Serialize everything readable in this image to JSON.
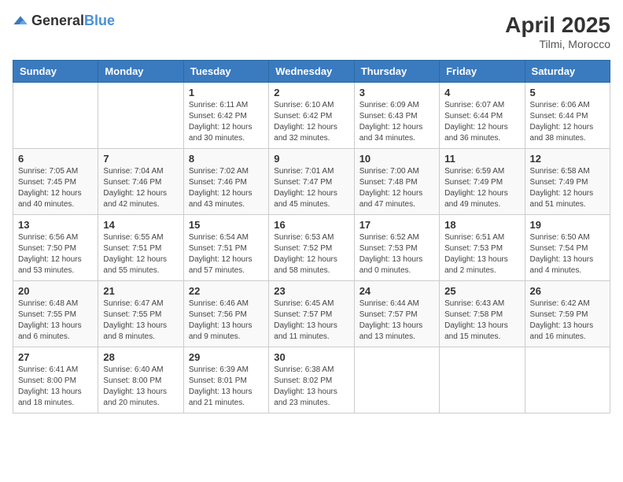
{
  "header": {
    "logo_general": "General",
    "logo_blue": "Blue",
    "month_title": "April 2025",
    "location": "Tilmi, Morocco"
  },
  "days_of_week": [
    "Sunday",
    "Monday",
    "Tuesday",
    "Wednesday",
    "Thursday",
    "Friday",
    "Saturday"
  ],
  "weeks": [
    [
      {
        "day": null,
        "info": null
      },
      {
        "day": null,
        "info": null
      },
      {
        "day": "1",
        "info": "Sunrise: 6:11 AM\nSunset: 6:42 PM\nDaylight: 12 hours and 30 minutes."
      },
      {
        "day": "2",
        "info": "Sunrise: 6:10 AM\nSunset: 6:42 PM\nDaylight: 12 hours and 32 minutes."
      },
      {
        "day": "3",
        "info": "Sunrise: 6:09 AM\nSunset: 6:43 PM\nDaylight: 12 hours and 34 minutes."
      },
      {
        "day": "4",
        "info": "Sunrise: 6:07 AM\nSunset: 6:44 PM\nDaylight: 12 hours and 36 minutes."
      },
      {
        "day": "5",
        "info": "Sunrise: 6:06 AM\nSunset: 6:44 PM\nDaylight: 12 hours and 38 minutes."
      }
    ],
    [
      {
        "day": "6",
        "info": "Sunrise: 7:05 AM\nSunset: 7:45 PM\nDaylight: 12 hours and 40 minutes."
      },
      {
        "day": "7",
        "info": "Sunrise: 7:04 AM\nSunset: 7:46 PM\nDaylight: 12 hours and 42 minutes."
      },
      {
        "day": "8",
        "info": "Sunrise: 7:02 AM\nSunset: 7:46 PM\nDaylight: 12 hours and 43 minutes."
      },
      {
        "day": "9",
        "info": "Sunrise: 7:01 AM\nSunset: 7:47 PM\nDaylight: 12 hours and 45 minutes."
      },
      {
        "day": "10",
        "info": "Sunrise: 7:00 AM\nSunset: 7:48 PM\nDaylight: 12 hours and 47 minutes."
      },
      {
        "day": "11",
        "info": "Sunrise: 6:59 AM\nSunset: 7:49 PM\nDaylight: 12 hours and 49 minutes."
      },
      {
        "day": "12",
        "info": "Sunrise: 6:58 AM\nSunset: 7:49 PM\nDaylight: 12 hours and 51 minutes."
      }
    ],
    [
      {
        "day": "13",
        "info": "Sunrise: 6:56 AM\nSunset: 7:50 PM\nDaylight: 12 hours and 53 minutes."
      },
      {
        "day": "14",
        "info": "Sunrise: 6:55 AM\nSunset: 7:51 PM\nDaylight: 12 hours and 55 minutes."
      },
      {
        "day": "15",
        "info": "Sunrise: 6:54 AM\nSunset: 7:51 PM\nDaylight: 12 hours and 57 minutes."
      },
      {
        "day": "16",
        "info": "Sunrise: 6:53 AM\nSunset: 7:52 PM\nDaylight: 12 hours and 58 minutes."
      },
      {
        "day": "17",
        "info": "Sunrise: 6:52 AM\nSunset: 7:53 PM\nDaylight: 13 hours and 0 minutes."
      },
      {
        "day": "18",
        "info": "Sunrise: 6:51 AM\nSunset: 7:53 PM\nDaylight: 13 hours and 2 minutes."
      },
      {
        "day": "19",
        "info": "Sunrise: 6:50 AM\nSunset: 7:54 PM\nDaylight: 13 hours and 4 minutes."
      }
    ],
    [
      {
        "day": "20",
        "info": "Sunrise: 6:48 AM\nSunset: 7:55 PM\nDaylight: 13 hours and 6 minutes."
      },
      {
        "day": "21",
        "info": "Sunrise: 6:47 AM\nSunset: 7:55 PM\nDaylight: 13 hours and 8 minutes."
      },
      {
        "day": "22",
        "info": "Sunrise: 6:46 AM\nSunset: 7:56 PM\nDaylight: 13 hours and 9 minutes."
      },
      {
        "day": "23",
        "info": "Sunrise: 6:45 AM\nSunset: 7:57 PM\nDaylight: 13 hours and 11 minutes."
      },
      {
        "day": "24",
        "info": "Sunrise: 6:44 AM\nSunset: 7:57 PM\nDaylight: 13 hours and 13 minutes."
      },
      {
        "day": "25",
        "info": "Sunrise: 6:43 AM\nSunset: 7:58 PM\nDaylight: 13 hours and 15 minutes."
      },
      {
        "day": "26",
        "info": "Sunrise: 6:42 AM\nSunset: 7:59 PM\nDaylight: 13 hours and 16 minutes."
      }
    ],
    [
      {
        "day": "27",
        "info": "Sunrise: 6:41 AM\nSunset: 8:00 PM\nDaylight: 13 hours and 18 minutes."
      },
      {
        "day": "28",
        "info": "Sunrise: 6:40 AM\nSunset: 8:00 PM\nDaylight: 13 hours and 20 minutes."
      },
      {
        "day": "29",
        "info": "Sunrise: 6:39 AM\nSunset: 8:01 PM\nDaylight: 13 hours and 21 minutes."
      },
      {
        "day": "30",
        "info": "Sunrise: 6:38 AM\nSunset: 8:02 PM\nDaylight: 13 hours and 23 minutes."
      },
      {
        "day": null,
        "info": null
      },
      {
        "day": null,
        "info": null
      },
      {
        "day": null,
        "info": null
      }
    ]
  ]
}
